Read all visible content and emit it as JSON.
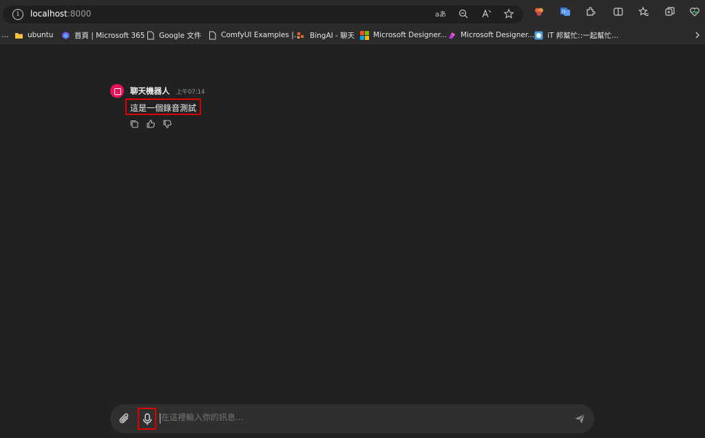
{
  "browser": {
    "address": {
      "host": "localhost",
      "port": ":8000"
    },
    "address_icons": [
      "read-aloud-icon",
      "zoom-out-icon",
      "immersive-reader-icon",
      "favorite-star-icon"
    ],
    "toolbar_icons": [
      "copilot-icon",
      "translate-icon",
      "extensions-icon",
      "split-screen-icon",
      "favorites-icon",
      "collections-icon",
      "browser-essentials-icon"
    ],
    "bookmarks": [
      {
        "label": "ubuntu",
        "icon": "folder-icon",
        "color": "#f5c242"
      },
      {
        "label": "首頁 | Microsoft 365",
        "icon": "microsoft365-icon",
        "color": "#7b5cff"
      },
      {
        "label": "Google 文件",
        "icon": "document-icon",
        "color": "#d8d8d8"
      },
      {
        "label": "ComfyUI Examples |...",
        "icon": "document-icon",
        "color": "#d8d8d8"
      },
      {
        "label": "BingAI - 聊天",
        "icon": "bingai-icon",
        "color": "#e8622a"
      },
      {
        "label": "Microsoft Designer...",
        "icon": "microsoft-logo-icon",
        "color": "#f25022"
      },
      {
        "label": "Microsoft Designer...",
        "icon": "designer-icon",
        "color": "#c13bd8"
      },
      {
        "label": "iT 邦幫忙::一起幫忙...",
        "icon": "ithome-icon",
        "color": "#4aa3df"
      }
    ]
  },
  "chat": {
    "message": {
      "sender": "聊天機器人",
      "time": "上午07:14",
      "text": "這是一個錄音測試"
    },
    "actions": [
      "copy-icon",
      "thumbs-up-icon",
      "thumbs-down-icon"
    ]
  },
  "composer": {
    "placeholder": "在這裡輸入你的訊息..."
  },
  "colors": {
    "background": "#212121",
    "avatar": "#e8115b",
    "highlight": "#e00000"
  }
}
